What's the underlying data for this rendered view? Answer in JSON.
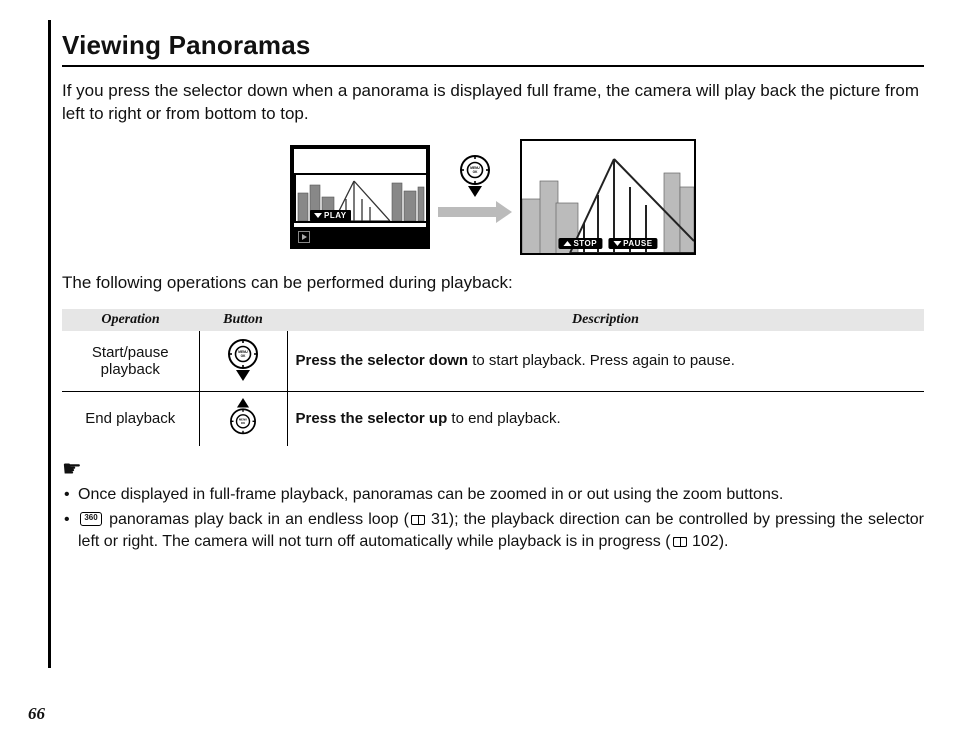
{
  "title": "Viewing Panoramas",
  "intro": "If you press the selector down when a panorama is displayed full frame, the camera will play back the picture from left to right or from bottom to top.",
  "illus": {
    "play_label": "PLAY",
    "stop_label": "STOP",
    "pause_label": "PAUSE"
  },
  "table_intro": "The following operations can be performed during playback:",
  "table": {
    "headers": {
      "operation": "Operation",
      "button": "Button",
      "description": "Description"
    },
    "rows": [
      {
        "operation": "Start/pause playback",
        "desc_bold": "Press the selector down",
        "desc_rest": " to start playback.  Press again to pause."
      },
      {
        "operation": "End playback",
        "desc_bold": "Press the selector up",
        "desc_rest": " to end playback."
      }
    ]
  },
  "notes": {
    "n1": "Once displayed in full-frame playback, panoramas can be zoomed in or out using the zoom buttons.",
    "n2_a": " panoramas play back in an endless loop (",
    "n2_ref1": " 31); the playback direction can be controlled by pressing the selector left or right.   The camera will not turn off automatically while playback is in progress (",
    "n2_ref2": " 102)."
  },
  "page_number": "66"
}
